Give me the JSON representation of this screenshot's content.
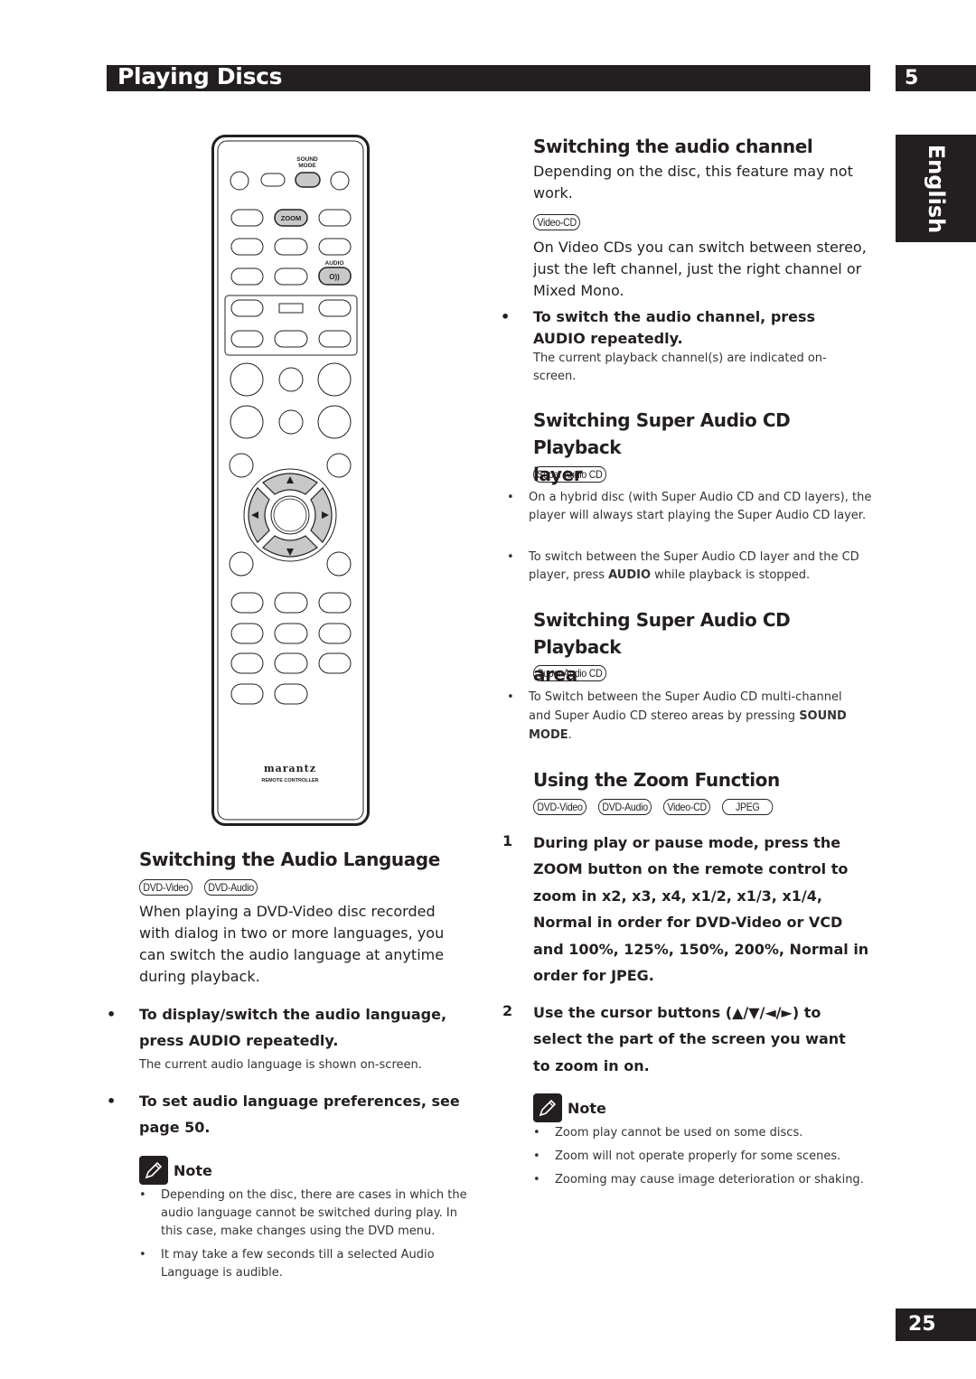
{
  "header": {
    "section_title": "Playing Discs",
    "chapter_number": "5",
    "language_tab": "English",
    "page_number": "25"
  },
  "remote": {
    "labels": {
      "sound_mode": "SOUND MODE",
      "zoom": "ZOOM",
      "audio": "AUDIO",
      "audio_glyph": "O))"
    },
    "brand": "marantz",
    "brand_sub": "REMOTE CONTROLLER",
    "cursor_glyphs": {
      "up": "▲",
      "down": "▼",
      "left": "◄",
      "right": "►"
    }
  },
  "audio_language": {
    "title": "Switching the Audio Language",
    "badges": [
      "DVD-Video",
      "DVD-Audio"
    ],
    "intro": "When playing a DVD-Video disc recorded with dialog in two or more languages, you can switch the audio language at anytime during playback.",
    "step1": "To display/switch the audio language, press AUDIO repeatedly.",
    "step1_note": "The current audio language is shown on-screen.",
    "step2": "To set audio language preferences, see page 50.",
    "note_label": "Note",
    "notes": [
      "Depending on the disc, there are cases in which the audio language cannot be switched during play.  In this case, make changes using the DVD menu.",
      "It may take a few seconds till a selected Audio Language is audible."
    ]
  },
  "audio_channel": {
    "title": "Switching the audio channel",
    "intro": "Depending on the disc, this feature may not work.",
    "badges": [
      "Video-CD"
    ],
    "desc": "On Video CDs you can switch between stereo, just the left channel, just the right channel or Mixed Mono.",
    "step": "To switch the audio channel, press AUDIO repeatedly.",
    "step_note": "The current playback channel(s) are indicated on-screen."
  },
  "sacd_layer": {
    "title_line1": "Switching Super Audio CD Playback",
    "title_line2": "layer",
    "badges": [
      "Super Audio CD"
    ],
    "bullets": [
      {
        "text": "On a hybrid disc (with Super Audio CD and CD layers), the player will always start playing the Super Audio CD layer."
      },
      {
        "pre": "To switch between the Super Audio CD layer and the CD player, press ",
        "bold": "AUDIO",
        "post": " while playback is stopped."
      }
    ]
  },
  "sacd_area": {
    "title_line1": "Switching Super Audio CD Playback",
    "title_line2": "area",
    "badges": [
      "Super Audio CD"
    ],
    "bullet": {
      "pre": "To Switch between the Super Audio CD multi-channel and Super Audio CD stereo areas by pressing ",
      "bold": "SOUND MODE",
      "post": "."
    }
  },
  "zoom_function": {
    "title": "Using the Zoom Function",
    "badges": [
      "DVD-Video",
      "DVD-Audio",
      "Video-CD",
      "JPEG"
    ],
    "steps": [
      {
        "num": "1",
        "text": "During play or pause mode, press the ZOOM button on the remote control to zoom in x2, x3, x4, x1/2, x1/3, x1/4, Normal in order for DVD-Video or VCD and 100%, 125%, 150%, 200%, Normal in order for JPEG."
      },
      {
        "num": "2",
        "text": "Use the cursor buttons (▲/▼/◄/►) to select the part of the screen you want to zoom in on."
      }
    ],
    "note_label": "Note",
    "notes": [
      "Zoom play cannot be used on some discs.",
      "Zoom will not operate properly for some scenes.",
      "Zooming may cause image deterioration or shaking."
    ]
  },
  "bullet_glyph": "•"
}
